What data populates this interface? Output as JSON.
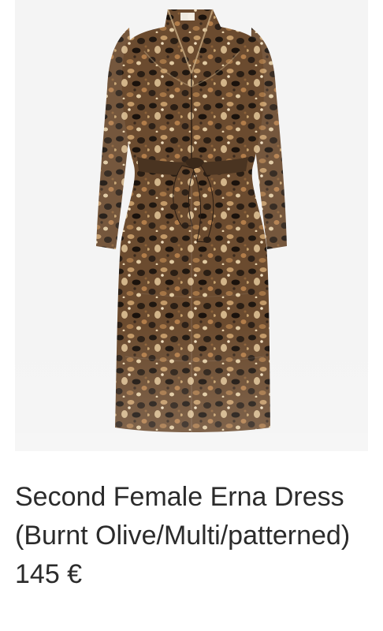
{
  "product": {
    "image_alt": "Second Female Erna Dress (Burnt Olive/Multi/patterned)",
    "title": "Second Female Erna Dress (Burnt Olive/Multi/patterned) 145 €"
  },
  "colors": {
    "panel_background": "#f4f4f4",
    "title_text": "#2b2b2b",
    "dress_base": "#6b4b2f",
    "dress_dark": "#1f1710",
    "dress_light": "#c39a68"
  }
}
